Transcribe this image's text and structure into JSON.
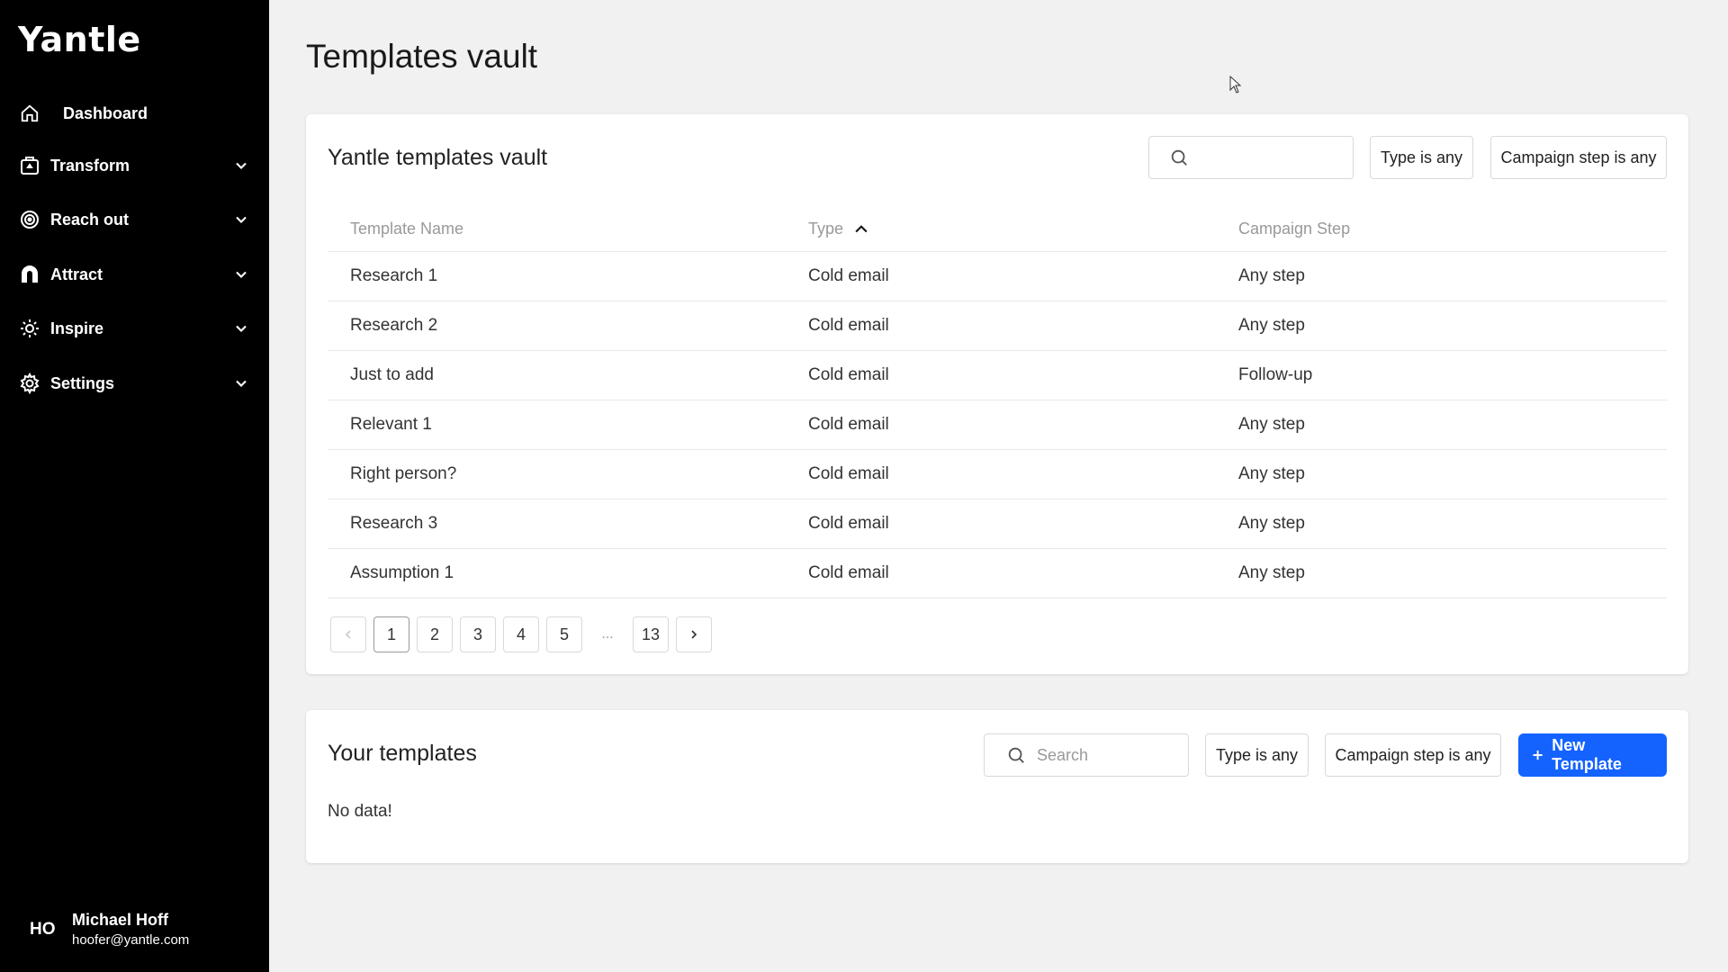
{
  "app": {
    "name": "Yantle"
  },
  "sidebar": {
    "items": [
      {
        "label": "Dashboard",
        "icon": "home-icon"
      },
      {
        "label": "Transform",
        "icon": "briefcase-icon"
      },
      {
        "label": "Reach out",
        "icon": "target-icon"
      },
      {
        "label": "Attract",
        "icon": "magnet-icon"
      },
      {
        "label": "Inspire",
        "icon": "sun-icon"
      },
      {
        "label": "Settings",
        "icon": "gear-icon"
      }
    ]
  },
  "user": {
    "initials": "HO",
    "name": "Michael Hoff",
    "email": "hoofer@yantle.com"
  },
  "page": {
    "title": "Templates vault"
  },
  "vault": {
    "title": "Yantle templates vault",
    "search_value": "",
    "filter_type": "Type is any",
    "filter_step": "Campaign step is any",
    "columns": [
      "Template Name",
      "Type",
      "Campaign Step"
    ],
    "rows": [
      {
        "name": "Research 1",
        "type": "Cold email",
        "step": "Any step"
      },
      {
        "name": "Research 2",
        "type": "Cold email",
        "step": "Any step"
      },
      {
        "name": "Just to add",
        "type": "Cold email",
        "step": "Follow-up"
      },
      {
        "name": "Relevant 1",
        "type": "Cold email",
        "step": "Any step"
      },
      {
        "name": "Right person?",
        "type": "Cold email",
        "step": "Any step"
      },
      {
        "name": "Research 3",
        "type": "Cold email",
        "step": "Any step"
      },
      {
        "name": "Assumption 1",
        "type": "Cold email",
        "step": "Any step"
      }
    ],
    "pagination": {
      "pages": [
        "1",
        "2",
        "3",
        "4",
        "5"
      ],
      "ellipsis": "...",
      "last": "13",
      "current": "1"
    }
  },
  "yours": {
    "title": "Your templates",
    "search_placeholder": "Search",
    "filter_type": "Type is any",
    "filter_step": "Campaign step is any",
    "new_button": "New Template",
    "empty": "No data!"
  },
  "colors": {
    "sidebar_bg": "#000000",
    "primary": "#1463ff",
    "page_bg": "#f1f1f1"
  }
}
